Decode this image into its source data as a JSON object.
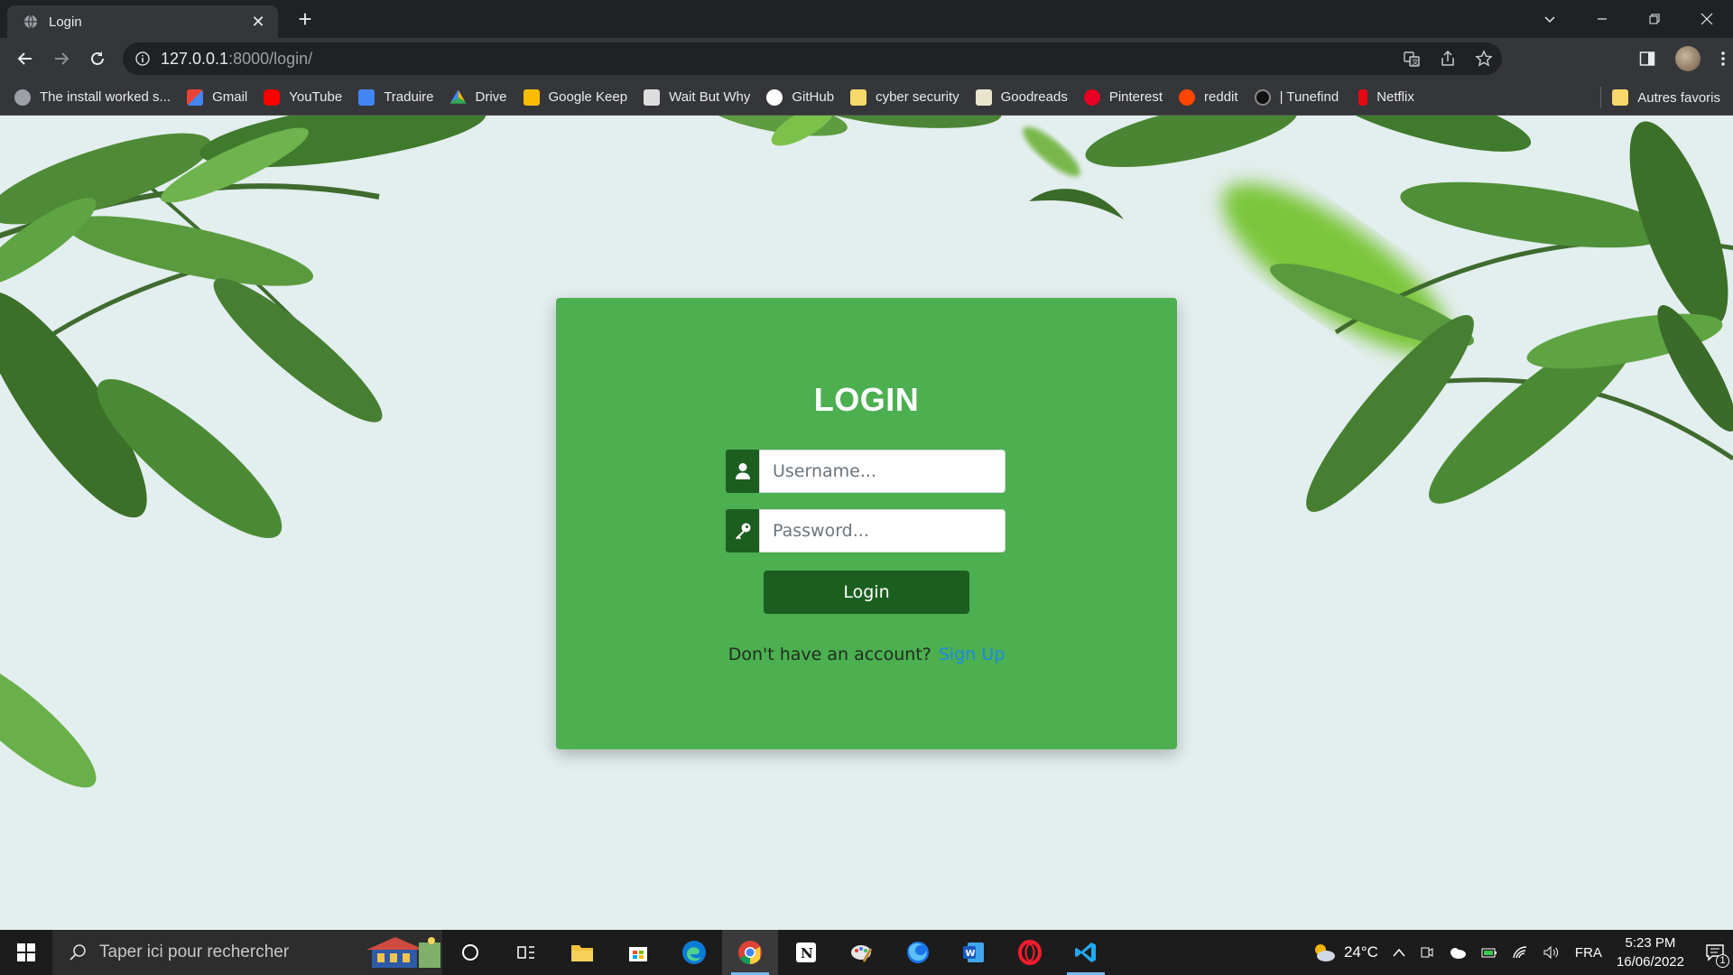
{
  "browser": {
    "tab": {
      "title": "Login",
      "favicon": "globe-icon"
    },
    "address": {
      "host": "127.0.0.1",
      "path": ":8000/login/"
    },
    "bookmarks": [
      {
        "label": "The install worked s...",
        "icon": "globe-icon",
        "color": "#9aa0a6"
      },
      {
        "label": "Gmail",
        "icon": "gmail-icon",
        "color": "#ea4335"
      },
      {
        "label": "YouTube",
        "icon": "youtube-icon",
        "color": "#ff0000"
      },
      {
        "label": "Traduire",
        "icon": "translate-icon",
        "color": "#4285f4"
      },
      {
        "label": "Drive",
        "icon": "drive-icon",
        "color": "#fbbc04"
      },
      {
        "label": "Google Keep",
        "icon": "keep-icon",
        "color": "#fbbc04"
      },
      {
        "label": "Wait But Why",
        "icon": "waitbutwhy-icon",
        "color": "#dddddd"
      },
      {
        "label": "GitHub",
        "icon": "github-icon",
        "color": "#ffffff"
      },
      {
        "label": "cyber security",
        "icon": "folder-icon",
        "color": "#f6d86b"
      },
      {
        "label": "Goodreads",
        "icon": "goodreads-icon",
        "color": "#e9e5cd"
      },
      {
        "label": "Pinterest",
        "icon": "pinterest-icon",
        "color": "#e60023"
      },
      {
        "label": "reddit",
        "icon": "reddit-icon",
        "color": "#ff4500"
      },
      {
        "label": "| Tunefind",
        "icon": "tunefind-icon",
        "color": "#111111"
      },
      {
        "label": "Netflix",
        "icon": "netflix-icon",
        "color": "#e50914"
      }
    ],
    "other_bookmarks": "Autres favoris"
  },
  "login": {
    "title": "LOGIN",
    "username_placeholder": "Username...",
    "password_placeholder": "Password...",
    "button_label": "Login",
    "signup_prompt": "Don't have an account?",
    "signup_link": "Sign Up"
  },
  "taskbar": {
    "search_placeholder": "Taper ici pour rechercher",
    "apps": [
      "cortana-icon",
      "task-view-icon",
      "file-explorer-icon",
      "store-icon",
      "edge-icon",
      "chrome-icon",
      "notion-icon",
      "paint-icon",
      "firefox-icon",
      "word-icon",
      "opera-icon",
      "vscode-icon"
    ],
    "weather": "24°C",
    "language": "FRA",
    "time": "5:23 PM",
    "date": "16/06/2022",
    "notifications": "1"
  },
  "colors": {
    "card": "#4caf50",
    "dark_green": "#1b5e20",
    "link": "#1e88e5",
    "page_bg": "#e3eeee"
  }
}
